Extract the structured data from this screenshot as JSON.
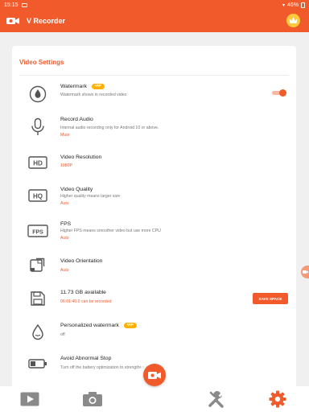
{
  "status_bar": {
    "time": "15:15",
    "battery": "46%"
  },
  "app": {
    "title": "V Recorder"
  },
  "colors": {
    "accent": "#f15a2b",
    "vip": "#ffb300"
  },
  "settings": {
    "section_title": "Video Settings",
    "watermark": {
      "title": "Watermark",
      "badge": "VIP",
      "description": "Watermark shows in recorded video",
      "enabled": true
    },
    "record_audio": {
      "title": "Record Audio",
      "description": "Internal audio recording only for Android 10 or above.",
      "value": "Mute"
    },
    "video_resolution": {
      "title": "Video Resolution",
      "value": "1080P"
    },
    "video_quality": {
      "title": "Video Quality",
      "description": "Higher quality means larger size",
      "value": "Auto"
    },
    "fps": {
      "title": "FPS",
      "description": "Higher FPS means smoother video but use more CPU",
      "value": "Auto"
    },
    "video_orientation": {
      "title": "Video Orientation",
      "value": "Auto"
    },
    "storage": {
      "title": "11.73 GB available",
      "value": "06:01:40.0 can be recorded",
      "button": "SAVE SPACE"
    },
    "personalized_watermark": {
      "title": "Personalized watermark",
      "badge": "VIP",
      "value": "off"
    },
    "avoid_abnormal_stop": {
      "title": "Avoid Abnormal Stop",
      "description": "Turn off the battery optimization to strengthen stability."
    }
  },
  "icons": {
    "watermark": "droplet-icon",
    "record_audio": "microphone-icon",
    "video_resolution": "hd-icon",
    "video_quality": "hq-icon",
    "fps": "fps-icon",
    "video_orientation": "rotate-screen-icon",
    "storage": "sd-card-icon",
    "personalized_watermark": "droplet-icon",
    "avoid_abnormal_stop": "battery-icon"
  },
  "hd_label": "HD",
  "hq_label": "HQ",
  "fps_label": "FPS",
  "bottom_nav": [
    "videos-tab",
    "screenshots-tab",
    "tools-tab",
    "settings-tab"
  ]
}
